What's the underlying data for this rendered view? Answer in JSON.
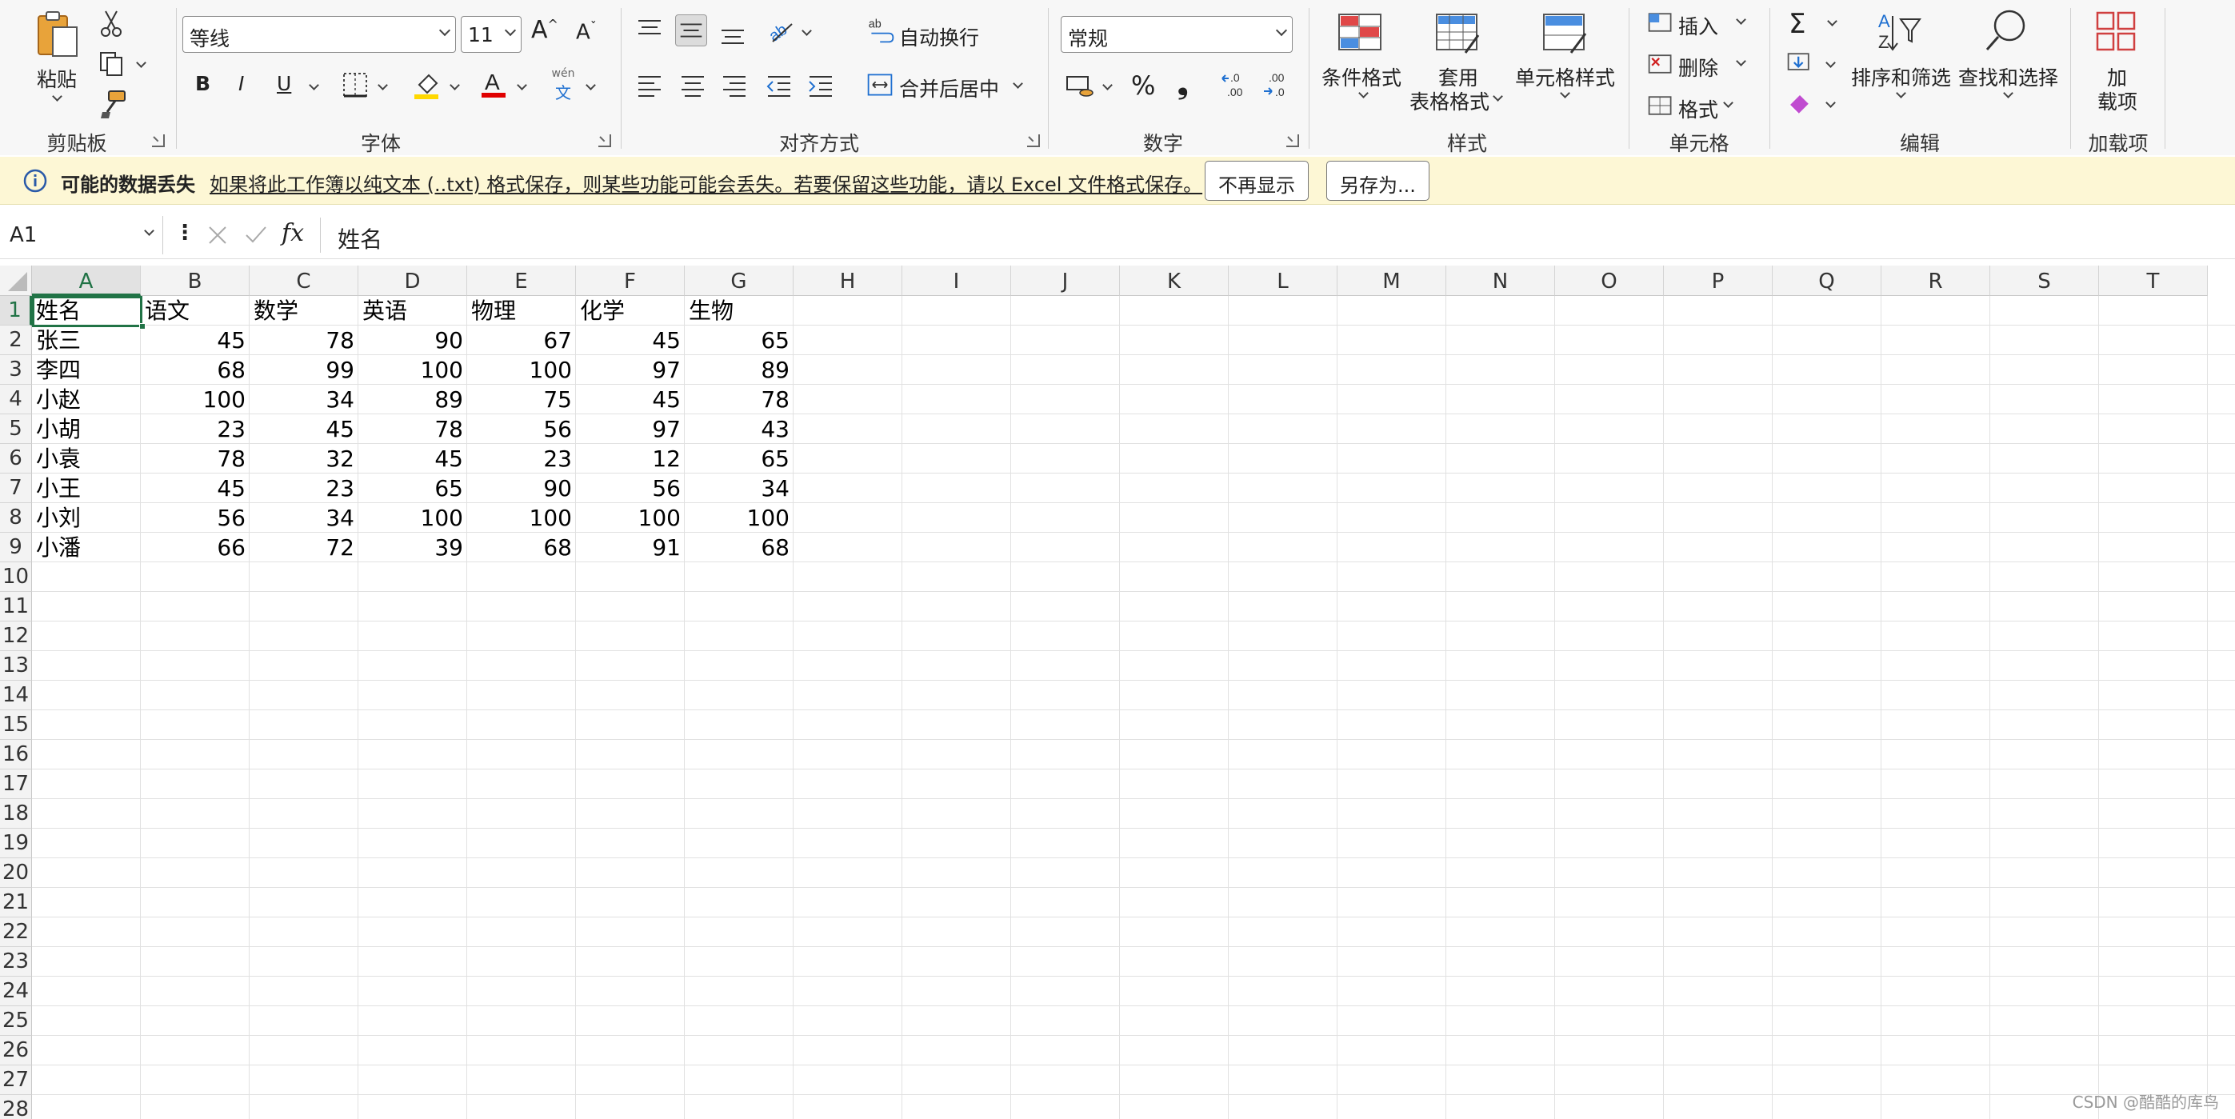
{
  "ribbon": {
    "clipboard": {
      "paste_label": "粘贴",
      "group_label": "剪贴板"
    },
    "font": {
      "font_name": "等线",
      "font_size": "11",
      "grow_label": "A",
      "shrink_label": "A",
      "bold": "B",
      "italic": "I",
      "underline": "U",
      "phonetic": "wén",
      "phonetic_char": "文",
      "group_label": "字体"
    },
    "alignment": {
      "wrap_label": "自动换行",
      "merge_label": "合并后居中",
      "group_label": "对齐方式"
    },
    "number": {
      "format": "常规",
      "percent": "%",
      "comma": "❟",
      "inc_decimal": "←.0\n.00",
      "group_label": "数字"
    },
    "styles": {
      "conditional": "条件格式",
      "table_line1": "套用",
      "table_line2": "表格格式",
      "cell_styles": "单元格样式",
      "group_label": "样式"
    },
    "cells": {
      "insert": "插入",
      "delete": "删除",
      "format": "格式",
      "group_label": "单元格"
    },
    "editing": {
      "sort_filter": "排序和筛选",
      "find_select": "查找和选择",
      "group_label": "编辑"
    },
    "addins": {
      "line1": "加",
      "line2": "载项",
      "group_label": "加载项"
    }
  },
  "infobar": {
    "title": "可能的数据丢失",
    "message": "如果将此工作簿以纯文本 (..txt) 格式保存，则某些功能可能会丢失。若要保留这些功能，请以 Excel 文件格式保存。",
    "dont_show": "不再显示",
    "save_as": "另存为..."
  },
  "formula_bar": {
    "cell_ref": "A1",
    "fx": "fx",
    "content": "姓名"
  },
  "columns": [
    "A",
    "B",
    "C",
    "D",
    "E",
    "F",
    "G",
    "H",
    "I",
    "J",
    "K",
    "L",
    "M",
    "N",
    "O",
    "P",
    "Q",
    "R",
    "S",
    "T"
  ],
  "rows": [
    "1",
    "2",
    "3",
    "4",
    "5",
    "6",
    "7",
    "8",
    "9",
    "10",
    "11",
    "12",
    "13",
    "14",
    "15",
    "16",
    "17",
    "18",
    "19",
    "20",
    "21",
    "22",
    "23",
    "24",
    "25",
    "26",
    "27",
    "28"
  ],
  "sheet": {
    "header": [
      "姓名",
      "语文",
      "数学",
      "英语",
      "物理",
      "化学",
      "生物"
    ],
    "data": [
      [
        "张三",
        "45",
        "78",
        "90",
        "67",
        "45",
        "65"
      ],
      [
        "李四",
        "68",
        "99",
        "100",
        "100",
        "97",
        "89"
      ],
      [
        "小赵",
        "100",
        "34",
        "89",
        "75",
        "45",
        "78"
      ],
      [
        "小胡",
        "23",
        "45",
        "78",
        "56",
        "97",
        "43"
      ],
      [
        "小袁",
        "78",
        "32",
        "45",
        "23",
        "12",
        "65"
      ],
      [
        "小王",
        "45",
        "23",
        "65",
        "90",
        "56",
        "34"
      ],
      [
        "小刘",
        "56",
        "34",
        "100",
        "100",
        "100",
        "100"
      ],
      [
        "小潘",
        "66",
        "72",
        "39",
        "68",
        "91",
        "68"
      ]
    ]
  },
  "watermark": "CSDN @酷酷的库鸟",
  "colors": {
    "selection": "#217346",
    "fill_yellow": "#ffd800",
    "font_red": "#e00000",
    "info_bg": "#fdf7d5"
  }
}
